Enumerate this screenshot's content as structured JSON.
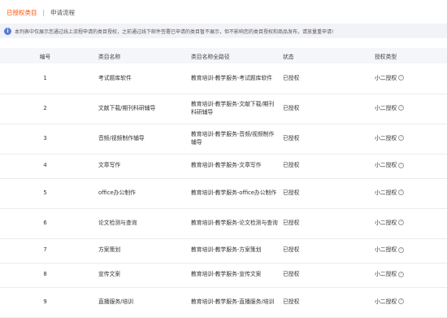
{
  "breadcrumb": {
    "current": "已授权类目",
    "separator": "|",
    "next": "申请流程"
  },
  "notice": {
    "icon": "info-icon",
    "text": "本列表中仅展示您通过线上流程申请的类目授权，之前通过线下邮件签署已申请的类目暂不展示，但不影响您的类目授权和商品发布，请放量重申请!"
  },
  "table": {
    "headers": [
      "编号",
      "类目名称",
      "类目名称全路径",
      "状态",
      "授权类型"
    ],
    "rows": [
      {
        "no": "1",
        "name": "考试题库软件",
        "path": "教育培训-教学服务-考试题库软件",
        "status": "已授权",
        "type": "小二授权"
      },
      {
        "no": "2",
        "name": "文献下载/期刊科研辅导",
        "path": "教育培训-教学服务-文献下载/期刊科研辅导",
        "status": "已授权",
        "type": "小二授权"
      },
      {
        "no": "3",
        "name": "音频/视频制作辅导",
        "path": "教育培训-教学服务-音频/视频制作辅导",
        "status": "已授权",
        "type": "小二授权"
      },
      {
        "no": "4",
        "name": "文章写作",
        "path": "教育培训-教学服务-文章写作",
        "status": "已授权",
        "type": "小二授权"
      },
      {
        "no": "5",
        "name": "office办公制作",
        "path": "教育培训-教学服务-office办公制作",
        "status": "已授权",
        "type": "小二授权"
      },
      {
        "no": "6",
        "name": "论文检测与查询",
        "path": "教育培训-教学服务-论文检测与查询",
        "status": "已授权",
        "type": "小二授权"
      },
      {
        "no": "7",
        "name": "方案策划",
        "path": "教育培训-教学服务-方案策划",
        "status": "已授权",
        "type": "小二授权"
      },
      {
        "no": "8",
        "name": "宣传文案",
        "path": "教育培训-教学服务-宣传文案",
        "status": "已授权",
        "type": "小二授权"
      },
      {
        "no": "9",
        "name": "直播服务/培训",
        "path": "教育培训-教学服务-直播服务/培训",
        "status": "已授权",
        "type": "小二授权"
      }
    ]
  },
  "colors": {
    "accent": "#ff5000",
    "notice_bg": "#f2f3f8",
    "info_icon": "#5b7bd5",
    "header_bg": "#f5f6fa"
  }
}
